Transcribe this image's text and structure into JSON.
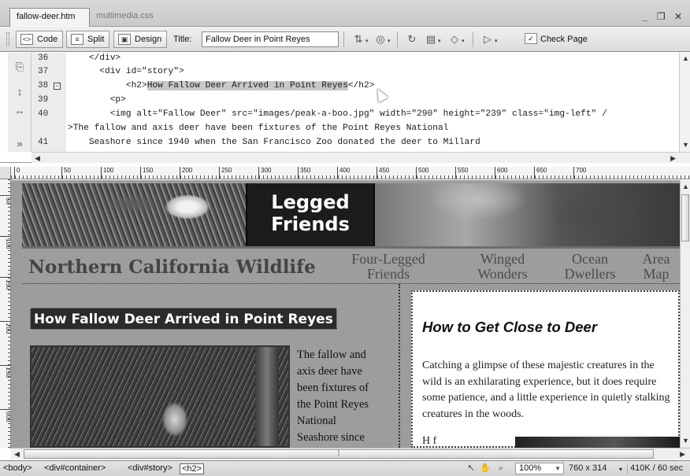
{
  "document_tabs": [
    {
      "label": "fallow-deer.htm",
      "active": true
    },
    {
      "label": "multimedia.css",
      "active": false
    }
  ],
  "window_controls": "_ ×",
  "toolbar": {
    "code_label": "Code",
    "split_label": "Split",
    "design_label": "Design",
    "title_label": "Title:",
    "title_value": "Fallow Deer in Point Reyes",
    "check_page_label": "Check Page"
  },
  "code": {
    "lines": [
      {
        "num": "36",
        "text": "    </div>"
      },
      {
        "num": "37",
        "text": "      <div id=\"story\">"
      },
      {
        "num": "38",
        "pre": "           <h2>",
        "sel": "How Fallow Deer Arrived in Point Reyes",
        "post": "</h2>"
      },
      {
        "num": "39",
        "text": "        <p>"
      },
      {
        "num": "40",
        "text": "        <img alt=\"Fallow Deer\" src=\"images/peak-a-boo.jpg\" width=\"290\" height=\"239\" class=\"img-left\" /"
      },
      {
        "num": "",
        "text": ">The fallow and axis deer have been fixtures of the Point Reyes National"
      },
      {
        "num": "41",
        "text": "    Seashore since 1940 when the San Francisco Zoo donated the deer to Millard"
      }
    ]
  },
  "ruler": {
    "h_ticks": [
      "0",
      "50",
      "100",
      "150",
      "200",
      "250",
      "300",
      "350",
      "400",
      "450",
      "500",
      "550",
      "600",
      "650",
      "700"
    ],
    "v_ticks": [
      "50",
      "100",
      "150",
      "200",
      "250",
      "300"
    ]
  },
  "page": {
    "banner_line1": "Legged",
    "banner_line2": "Friends",
    "site_name": "Northern California Wildlife",
    "nav": [
      {
        "line1": "Four-Legged",
        "line2": "Friends"
      },
      {
        "line1": "Winged",
        "line2": "Wonders"
      },
      {
        "line1": "Ocean",
        "line2": "Dwellers"
      },
      {
        "line1": "Area",
        "line2": "Map"
      }
    ],
    "story_heading": "How Fallow Deer Arrived in Point Reyes",
    "story_text_lines": [
      "The fallow and",
      "axis deer have",
      "been fixtures of",
      "the Point Reyes",
      "National",
      "Seashore since"
    ],
    "sidebar_heading": "How to Get Close to Deer",
    "sidebar_text": "Catching a glimpse of these majestic creatures in the wild is an exhilarating experience, but it does require some patience, and a little experience in quietly stalking creatures in the woods.",
    "sidebar_text2": "H            f"
  },
  "status": {
    "tags": [
      "<body>",
      "<div#container>",
      "<div#story>",
      "<h2>"
    ],
    "zoom": "100%",
    "window_size": "760 x 314",
    "download": "410K / 60 sec"
  },
  "colors": {
    "selection": "#c8c8c8",
    "page_bg": "#9d9d9d",
    "heading_bg": "#2b2b2b"
  }
}
